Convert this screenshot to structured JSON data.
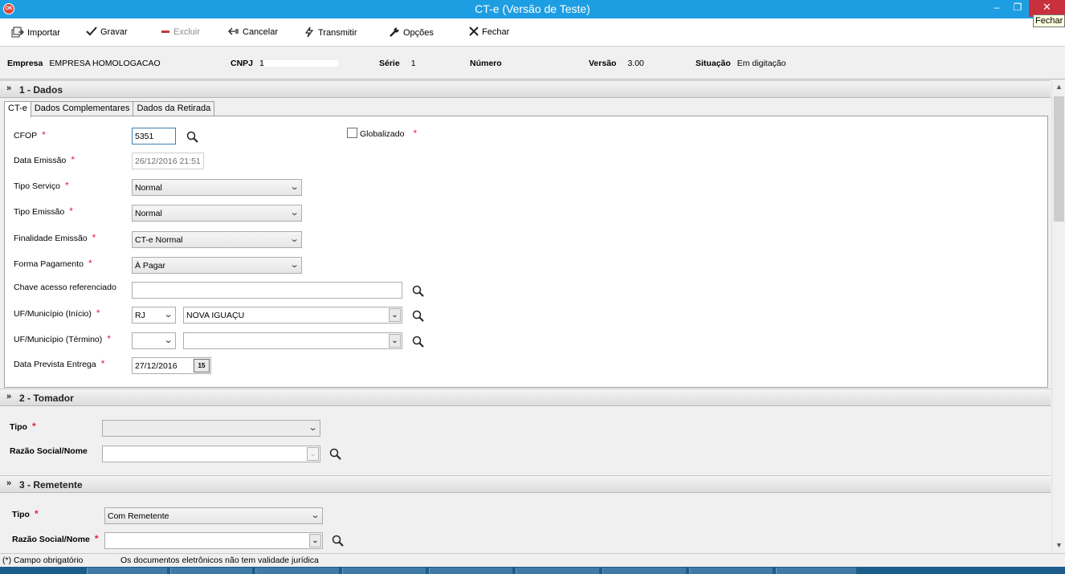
{
  "window": {
    "title": "CT-e (Versão de Teste)",
    "icon_text": "OK",
    "close_tooltip": "Fechar",
    "minimize_glyph": "–",
    "maximize_glyph": "❐",
    "close_glyph": "✕"
  },
  "toolbar": {
    "importar": "Importar",
    "gravar": "Gravar",
    "excluir": "Excluir",
    "cancelar": "Cancelar",
    "transmitir": "Transmitir",
    "opcoes": "Opções",
    "fechar": "Fechar"
  },
  "info": {
    "empresa_label": "Empresa",
    "empresa_value": "EMPRESA HOMOLOGACAO",
    "cnpj_label": "CNPJ",
    "cnpj_value": "1",
    "serie_label": "Série",
    "serie_value": "1",
    "numero_label": "Número",
    "numero_value": "",
    "versao_label": "Versão",
    "versao_value": "3.00",
    "situacao_label": "Situação",
    "situacao_value": "Em digitação"
  },
  "sections": {
    "dados": "1 - Dados",
    "tomador": "2 - Tomador",
    "remetente": "3 - Remetente"
  },
  "tabs": [
    "CT-e",
    "Dados Complementares",
    "Dados da Retirada"
  ],
  "form": {
    "cfop_label": "CFOP",
    "cfop_value": "5351",
    "globalizado_label": "Globalizado",
    "data_emissao_label": "Data Emissão",
    "data_emissao_value": "26/12/2016 21:51",
    "tipo_servico_label": "Tipo Serviço",
    "tipo_servico_value": "Normal",
    "tipo_emissao_label": "Tipo Emissão",
    "tipo_emissao_value": "Normal",
    "finalidade_label": "Finalidade Emissão",
    "finalidade_value": "CT-e Normal",
    "forma_pagamento_label": "Forma Pagamento",
    "forma_pagamento_value": "À Pagar",
    "chave_label": "Chave acesso referenciado",
    "chave_value": "",
    "uf_inicio_label": "UF/Município (Início)",
    "uf_inicio_uf": "RJ",
    "uf_inicio_municipio": "NOVA IGUAÇU",
    "uf_termino_label": "UF/Município (Término)",
    "uf_termino_uf": "",
    "uf_termino_municipio": "",
    "data_prevista_label": "Data Prevista Entrega",
    "data_prevista_value": "27/12/2016",
    "calendar_glyph": "15"
  },
  "tomador": {
    "tipo_label": "Tipo",
    "tipo_value": "",
    "razao_label": "Razão Social/Nome",
    "razao_value": ""
  },
  "remetente": {
    "tipo_label": "Tipo",
    "tipo_value": "Com Remetente",
    "razao_label": "Razão Social/Nome",
    "razao_value": ""
  },
  "status": {
    "campo_obrigatorio": "(*) Campo obrigatório",
    "aviso": "Os documentos eletrônicos não tem validade jurídica"
  },
  "required_mark": "*",
  "colors": {
    "titlebar": "#1e9ee2",
    "close_button": "#c7303c",
    "required": "#e0203a"
  }
}
